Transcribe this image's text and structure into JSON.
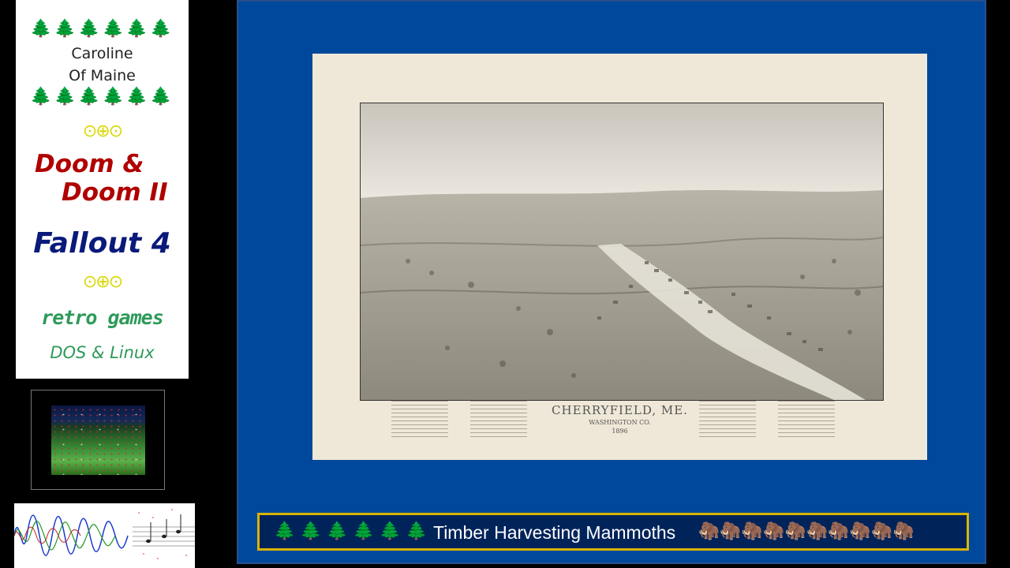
{
  "sidebar": {
    "trees_top": "🌲🌲🌲🌲🌲🌲",
    "channel_line1": "Caroline",
    "channel_line2": "Of Maine",
    "trees_bottom": "🌲🌲🌲🌲🌲🌲",
    "rings_1": "⊙⊕⊙",
    "doom_line1": "Doom &",
    "doom_line2": "Doom II",
    "fallout": "Fallout 4",
    "rings_2": "⊙⊕⊙",
    "retro_games": "retro games",
    "dos_linux": "DOS & Linux"
  },
  "main": {
    "map": {
      "title": "CHERRYFIELD, ME.",
      "subtitle": "WASHINGTON CO.",
      "year": "1896"
    },
    "caption": {
      "trees": "🌲🌲🌲🌲🌲🌲",
      "title": "Timber Harvesting Mammoths",
      "mammoths": "🦣🦣🦣🦣🦣🦣🦣🦣🦣🦣"
    }
  },
  "colors": {
    "panel_blue": "#00489c",
    "caption_border": "#d8b400",
    "doom_red": "#b00000",
    "fallout_navy": "#0a1a7a",
    "retro_green": "#2e9a5a"
  }
}
